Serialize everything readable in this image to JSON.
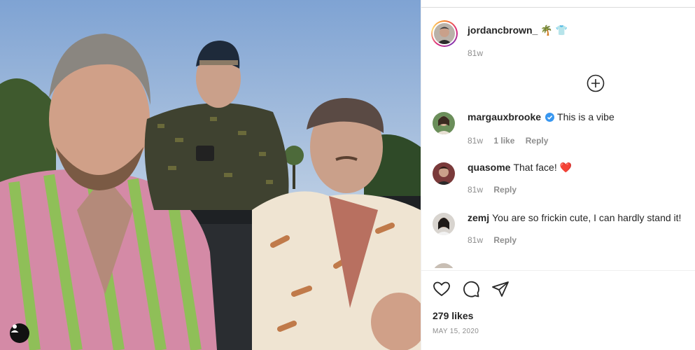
{
  "post": {
    "author": {
      "username": "jordancbrown_",
      "emojis": "🌴 👕",
      "time": "81w"
    },
    "likes": "279 likes",
    "date": "MAY 15, 2020"
  },
  "comments": [
    {
      "user": "margauxbrooke",
      "verified": true,
      "text": "This is a vibe",
      "time": "81w",
      "likes": "1 like",
      "reply": "Reply"
    },
    {
      "user": "quasome",
      "verified": false,
      "text": "That face! ❤️",
      "time": "81w",
      "likes": "",
      "reply": "Reply"
    },
    {
      "user": "zemj",
      "verified": false,
      "text": "You are so frickin cute, I can hardly stand it!",
      "time": "81w",
      "likes": "",
      "reply": "Reply"
    }
  ],
  "icons": {
    "add_comment": "plus-circle-icon",
    "like": "heart-icon",
    "comment": "comment-bubble-icon",
    "share": "paper-plane-icon",
    "tagged_user": "user-tag-icon",
    "verified": "verified-badge-icon"
  },
  "colors": {
    "verified": "#3897f0",
    "heart": "#ed4956",
    "muted_text": "#8e8e8e"
  }
}
